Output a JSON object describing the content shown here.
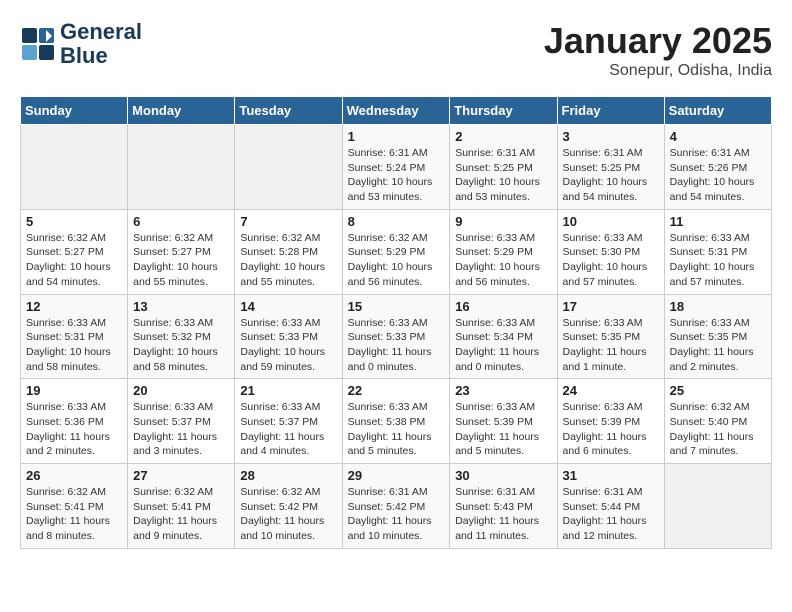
{
  "header": {
    "logo_line1": "General",
    "logo_line2": "Blue",
    "month_title": "January 2025",
    "subtitle": "Sonepur, Odisha, India"
  },
  "weekdays": [
    "Sunday",
    "Monday",
    "Tuesday",
    "Wednesday",
    "Thursday",
    "Friday",
    "Saturday"
  ],
  "weeks": [
    [
      {
        "day": "",
        "info": ""
      },
      {
        "day": "",
        "info": ""
      },
      {
        "day": "",
        "info": ""
      },
      {
        "day": "1",
        "info": "Sunrise: 6:31 AM\nSunset: 5:24 PM\nDaylight: 10 hours\nand 53 minutes."
      },
      {
        "day": "2",
        "info": "Sunrise: 6:31 AM\nSunset: 5:25 PM\nDaylight: 10 hours\nand 53 minutes."
      },
      {
        "day": "3",
        "info": "Sunrise: 6:31 AM\nSunset: 5:25 PM\nDaylight: 10 hours\nand 54 minutes."
      },
      {
        "day": "4",
        "info": "Sunrise: 6:31 AM\nSunset: 5:26 PM\nDaylight: 10 hours\nand 54 minutes."
      }
    ],
    [
      {
        "day": "5",
        "info": "Sunrise: 6:32 AM\nSunset: 5:27 PM\nDaylight: 10 hours\nand 54 minutes."
      },
      {
        "day": "6",
        "info": "Sunrise: 6:32 AM\nSunset: 5:27 PM\nDaylight: 10 hours\nand 55 minutes."
      },
      {
        "day": "7",
        "info": "Sunrise: 6:32 AM\nSunset: 5:28 PM\nDaylight: 10 hours\nand 55 minutes."
      },
      {
        "day": "8",
        "info": "Sunrise: 6:32 AM\nSunset: 5:29 PM\nDaylight: 10 hours\nand 56 minutes."
      },
      {
        "day": "9",
        "info": "Sunrise: 6:33 AM\nSunset: 5:29 PM\nDaylight: 10 hours\nand 56 minutes."
      },
      {
        "day": "10",
        "info": "Sunrise: 6:33 AM\nSunset: 5:30 PM\nDaylight: 10 hours\nand 57 minutes."
      },
      {
        "day": "11",
        "info": "Sunrise: 6:33 AM\nSunset: 5:31 PM\nDaylight: 10 hours\nand 57 minutes."
      }
    ],
    [
      {
        "day": "12",
        "info": "Sunrise: 6:33 AM\nSunset: 5:31 PM\nDaylight: 10 hours\nand 58 minutes."
      },
      {
        "day": "13",
        "info": "Sunrise: 6:33 AM\nSunset: 5:32 PM\nDaylight: 10 hours\nand 58 minutes."
      },
      {
        "day": "14",
        "info": "Sunrise: 6:33 AM\nSunset: 5:33 PM\nDaylight: 10 hours\nand 59 minutes."
      },
      {
        "day": "15",
        "info": "Sunrise: 6:33 AM\nSunset: 5:33 PM\nDaylight: 11 hours\nand 0 minutes."
      },
      {
        "day": "16",
        "info": "Sunrise: 6:33 AM\nSunset: 5:34 PM\nDaylight: 11 hours\nand 0 minutes."
      },
      {
        "day": "17",
        "info": "Sunrise: 6:33 AM\nSunset: 5:35 PM\nDaylight: 11 hours\nand 1 minute."
      },
      {
        "day": "18",
        "info": "Sunrise: 6:33 AM\nSunset: 5:35 PM\nDaylight: 11 hours\nand 2 minutes."
      }
    ],
    [
      {
        "day": "19",
        "info": "Sunrise: 6:33 AM\nSunset: 5:36 PM\nDaylight: 11 hours\nand 2 minutes."
      },
      {
        "day": "20",
        "info": "Sunrise: 6:33 AM\nSunset: 5:37 PM\nDaylight: 11 hours\nand 3 minutes."
      },
      {
        "day": "21",
        "info": "Sunrise: 6:33 AM\nSunset: 5:37 PM\nDaylight: 11 hours\nand 4 minutes."
      },
      {
        "day": "22",
        "info": "Sunrise: 6:33 AM\nSunset: 5:38 PM\nDaylight: 11 hours\nand 5 minutes."
      },
      {
        "day": "23",
        "info": "Sunrise: 6:33 AM\nSunset: 5:39 PM\nDaylight: 11 hours\nand 5 minutes."
      },
      {
        "day": "24",
        "info": "Sunrise: 6:33 AM\nSunset: 5:39 PM\nDaylight: 11 hours\nand 6 minutes."
      },
      {
        "day": "25",
        "info": "Sunrise: 6:32 AM\nSunset: 5:40 PM\nDaylight: 11 hours\nand 7 minutes."
      }
    ],
    [
      {
        "day": "26",
        "info": "Sunrise: 6:32 AM\nSunset: 5:41 PM\nDaylight: 11 hours\nand 8 minutes."
      },
      {
        "day": "27",
        "info": "Sunrise: 6:32 AM\nSunset: 5:41 PM\nDaylight: 11 hours\nand 9 minutes."
      },
      {
        "day": "28",
        "info": "Sunrise: 6:32 AM\nSunset: 5:42 PM\nDaylight: 11 hours\nand 10 minutes."
      },
      {
        "day": "29",
        "info": "Sunrise: 6:31 AM\nSunset: 5:42 PM\nDaylight: 11 hours\nand 10 minutes."
      },
      {
        "day": "30",
        "info": "Sunrise: 6:31 AM\nSunset: 5:43 PM\nDaylight: 11 hours\nand 11 minutes."
      },
      {
        "day": "31",
        "info": "Sunrise: 6:31 AM\nSunset: 5:44 PM\nDaylight: 11 hours\nand 12 minutes."
      },
      {
        "day": "",
        "info": ""
      }
    ]
  ]
}
